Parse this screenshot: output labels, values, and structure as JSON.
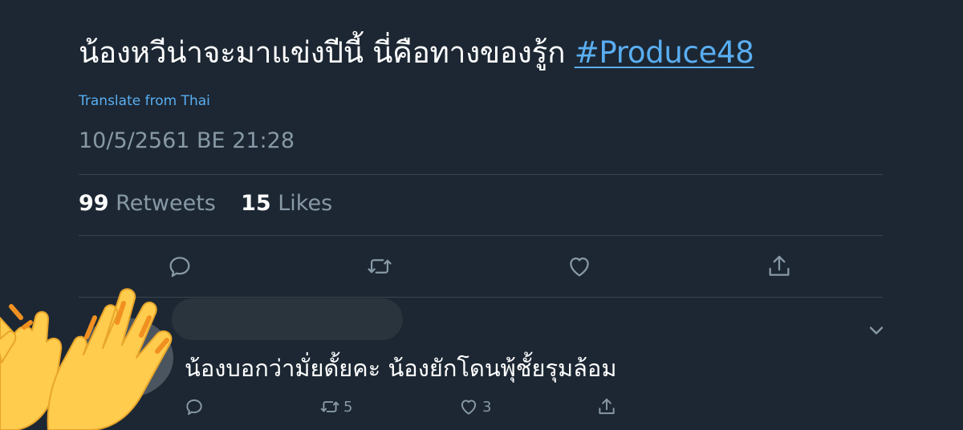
{
  "tweet": {
    "text": "น้องหวีน่าจะมาแข่งปีนี้ นี่คือทางของรู้ก",
    "hashtag": "#Produce48",
    "translate_link": "Translate from Thai",
    "timestamp": "10/5/2561 BE 21:28"
  },
  "stats": {
    "retweets_count": "99",
    "retweets_label": "Retweets",
    "likes_count": "15",
    "likes_label": "Likes"
  },
  "actions": {
    "reply_icon": "reply-icon",
    "retweet_icon": "retweet-icon",
    "like_icon": "heart-icon",
    "share_icon": "share-icon"
  },
  "reply": {
    "text": "น้องบอกว่ามั่ยดั้ยคะ น้องยักโดนพุ้ชั้ยรุมล้อม",
    "retweet_count": "5",
    "like_count": "3",
    "overlay_emoji": "raised-hands-emoji"
  },
  "colors": {
    "background": "#1c2733",
    "accent": "#5aaef2",
    "muted": "#8899a6",
    "divider": "#38444d"
  }
}
